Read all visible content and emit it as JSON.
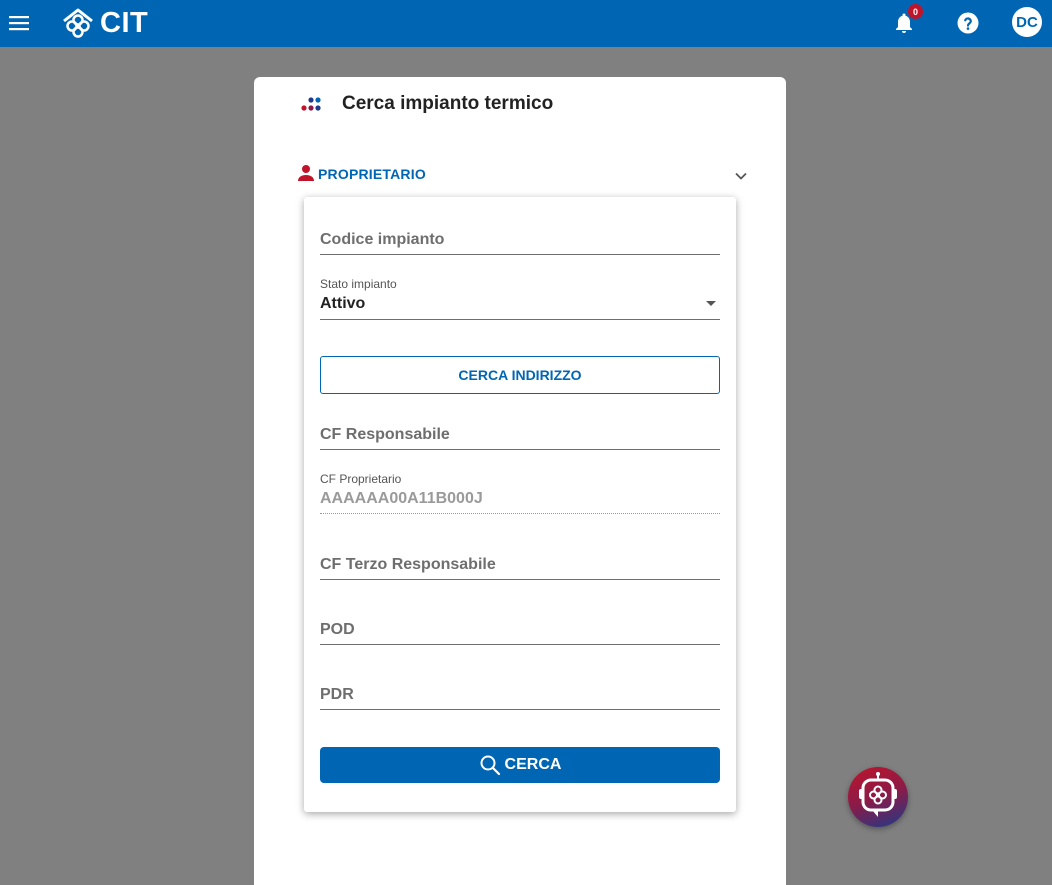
{
  "header": {
    "app_name": "CIT",
    "notifications_count": "0",
    "user_initials": "DC",
    "icons": [
      "menu-icon",
      "cit-logo-icon",
      "bell-icon",
      "help-icon"
    ]
  },
  "card": {
    "title": "Cerca impianto termico",
    "section_label": "PROPRIETARIO"
  },
  "form": {
    "codice_impianto_placeholder": "Codice impianto",
    "stato_impianto_label": "Stato impianto",
    "stato_impianto_value": "Attivo",
    "cerca_indirizzo_label": "CERCA INDIRIZZO",
    "cf_responsabile_placeholder": "CF Responsabile",
    "cf_proprietario_label": "CF Proprietario",
    "cf_proprietario_value": "AAAAAA00A11B000J",
    "cf_terzo_responsabile_placeholder": "CF Terzo Responsabile",
    "pod_placeholder": "POD",
    "pdr_placeholder": "PDR",
    "cerca_label": "CERCA"
  },
  "colors": {
    "primary": "#0066b3",
    "background": "#808080",
    "badge": "#c0142a"
  }
}
